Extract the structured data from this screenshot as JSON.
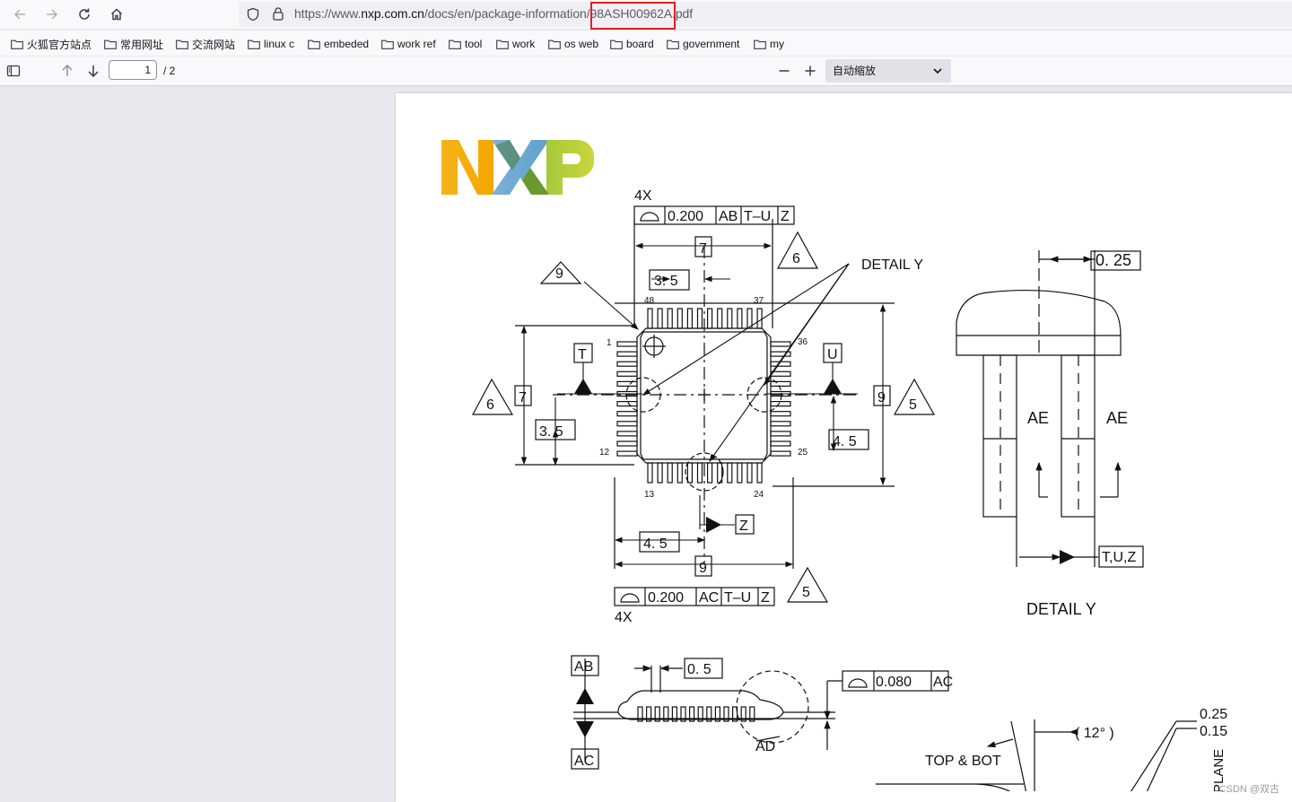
{
  "browser": {
    "url_prefix": "https://www.",
    "url_host": "nxp.com.cn",
    "url_path": "/docs/en/package-information/98ASH00962A.pdf",
    "bookmarks": [
      "火狐官方站点",
      "常用网址",
      "交流网站",
      "linux c",
      "embeded",
      "work ref",
      "tool",
      "work",
      "os web",
      "board",
      "government",
      "my"
    ],
    "icons": [
      "back-icon",
      "forward-icon",
      "reload-icon",
      "home-icon",
      "shield-icon",
      "lock-icon",
      "folder-icon"
    ]
  },
  "pdf_toolbar": {
    "current_page": "1",
    "total_pages": "/ 2",
    "zoom": "自动缩放",
    "icons": [
      "sidebar-toggle-icon",
      "previous-page-icon",
      "next-page-icon",
      "zoom-out-icon",
      "zoom-in-icon",
      "chevron-down-icon"
    ]
  },
  "document": {
    "logo": "NXP",
    "labels": {
      "four_x_top": "4X",
      "four_x_bottom": "4X",
      "fcf_top": [
        "0.200",
        "AB",
        "T–U",
        "Z"
      ],
      "fcf_bottom": [
        "0.200",
        "AC",
        "T–U",
        "Z"
      ],
      "fcf_side": [
        "0.080",
        "AC"
      ],
      "dim_7_top": "7",
      "dim_7_left": "7",
      "dim_9_right": "9",
      "dim_9_bottom": "9",
      "dim_35_top": "3. 5",
      "dim_35_left": "3. 5",
      "dim_45_right": "4. 5",
      "dim_45_bottom": "4. 5",
      "dim_05": "0. 5",
      "dim_025_detail": "0. 25",
      "note_9": "9",
      "note_6_top": "6",
      "note_6_left": "6",
      "note_5_right": "5",
      "note_5_bottom": "5",
      "datum_t": "T",
      "datum_u": "U",
      "datum_z": "Z",
      "datum_ab": "AB",
      "datum_ac": "AC",
      "datum_ad": "AD",
      "datum_tuz": "T,U,Z",
      "detail_y_callout": "DETAIL  Y",
      "detail_y_title": "DETAIL  Y",
      "ae_left": "AE",
      "ae_right": "AE",
      "pin_1": "1",
      "pin_12": "12",
      "pin_13": "13",
      "pin_24": "24",
      "pin_25": "25",
      "pin_36": "36",
      "pin_37": "37",
      "pin_48": "48",
      "angle_12": "( 12° )",
      "top_bot": "TOP  &  BOT",
      "val_025": "0.25",
      "val_015": "0.15",
      "plane": "PLANE"
    },
    "watermark": "CSDN @双古"
  }
}
